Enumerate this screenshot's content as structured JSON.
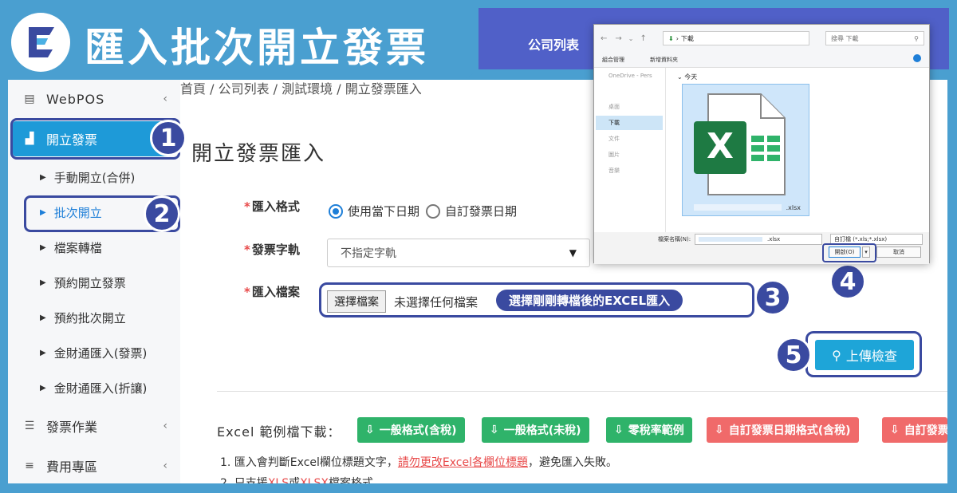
{
  "banner": {
    "title": "匯入批次開立發票",
    "logo_letter": "E"
  },
  "topbar": {
    "company_list": "公司列表"
  },
  "breadcrumb": {
    "text": "首頁 / 公司列表 / 測試環境 / 開立發票匯入"
  },
  "sidebar": {
    "items": [
      {
        "label": "WebPOS",
        "icon": "calculator-icon"
      },
      {
        "label": "開立發票",
        "icon": "sitemap-icon"
      },
      {
        "label": "發票作業",
        "icon": "list-icon"
      },
      {
        "label": "費用專區",
        "icon": "bars-icon"
      }
    ],
    "sub_items": [
      "手動開立(合併)",
      "批次開立",
      "檔案轉檔",
      "預約開立發票",
      "預約批次開立",
      "金財通匯入(發票)",
      "金財通匯入(折讓)"
    ]
  },
  "page_title": "開立發票匯入",
  "form": {
    "format_label": "匯入格式",
    "format_options": [
      "使用當下日期",
      "自訂發票日期"
    ],
    "format_selected": "使用當下日期",
    "track_label": "發票字軌",
    "track_value": "不指定字軌",
    "file_label": "匯入檔案",
    "choose_file": "選擇檔案",
    "no_file": "未選擇任何檔案",
    "file_hint": "選擇剛剛轉檔後的EXCEL匯入",
    "upload_button": "上傳檢查"
  },
  "download": {
    "label": "Excel 範例檔下載：",
    "buttons": [
      {
        "label": "一般格式(含稅)",
        "color": "#2fb36a"
      },
      {
        "label": "一般格式(未稅)",
        "color": "#2fb36a"
      },
      {
        "label": "零稅率範例",
        "color": "#2fb36a"
      },
      {
        "label": "自訂發票日期格式(含稅)",
        "color": "#f06a6a"
      },
      {
        "label": "自訂發票",
        "color": "#f06a6a"
      }
    ]
  },
  "notes": {
    "n1_pre": "1. 匯入會判斷Excel欄位標題文字，",
    "n1_link": "請勿更改Excel各欄位標題",
    "n1_post": "，避免匯入失敗。",
    "n2_pre": "2. 只支援",
    "n2_xls": "XLS",
    "n2_mid": "或",
    "n2_xlsx": "XLSX",
    "n2_post": "檔案格式。"
  },
  "steps": [
    "1",
    "2",
    "3",
    "4",
    "5"
  ],
  "dialog": {
    "path": "下載",
    "search_placeholder": "搜尋 下載",
    "organize": "組合管理",
    "new_folder": "新增資料夾",
    "left_items": [
      "OneDrive - Pers",
      "桌面",
      "下載",
      "文件",
      "圖片",
      "音樂"
    ],
    "today": "今天",
    "file_name": ".xlsx",
    "file_tile_letter": "X",
    "filename_label": "檔案名稱(N):",
    "filename_value": ".xlsx",
    "filter": "自訂檔 (*.xls;*.xlsx)",
    "open_button": "開啟(O)",
    "cancel_button": "取消"
  },
  "colors": {
    "banner": "#4a9fd0",
    "accent": "#3a4aa0",
    "primary": "#1e9ad8",
    "green": "#2fb36a",
    "red": "#f06a6a"
  }
}
